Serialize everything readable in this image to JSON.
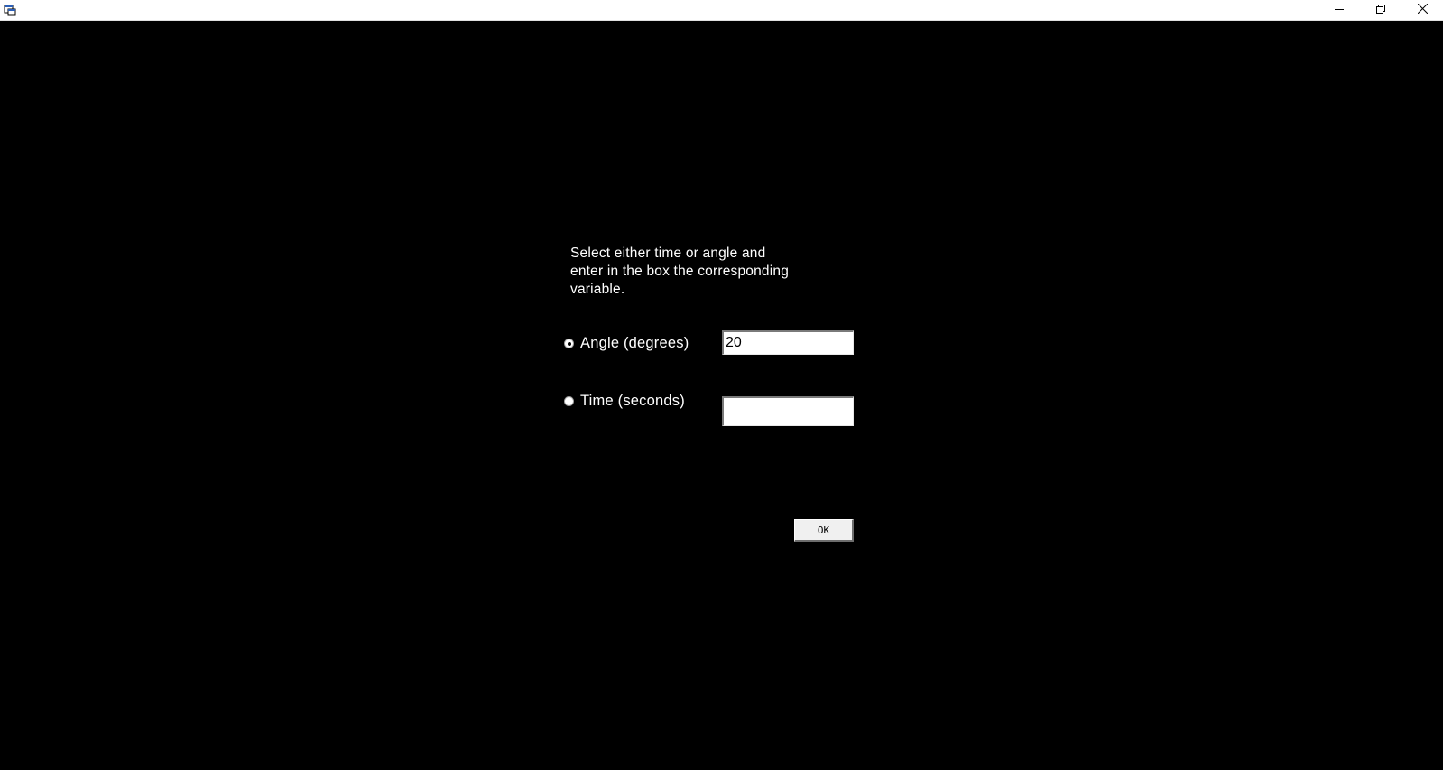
{
  "window": {
    "icons": {
      "app": "app-window-icon",
      "minimize": "minimize-icon",
      "restore": "restore-icon",
      "close": "close-icon"
    }
  },
  "dialog": {
    "instructions": "Select either time or angle and\nenter in the box the corresponding\nvariable.",
    "options": [
      {
        "label": "Angle (degrees)",
        "selected": true,
        "value": "20"
      },
      {
        "label": "Time (seconds)",
        "selected": false,
        "value": ""
      }
    ],
    "ok_label": "OK"
  },
  "colors": {
    "background": "#000000",
    "text": "#ffffff",
    "titlebar": "#ffffff"
  }
}
